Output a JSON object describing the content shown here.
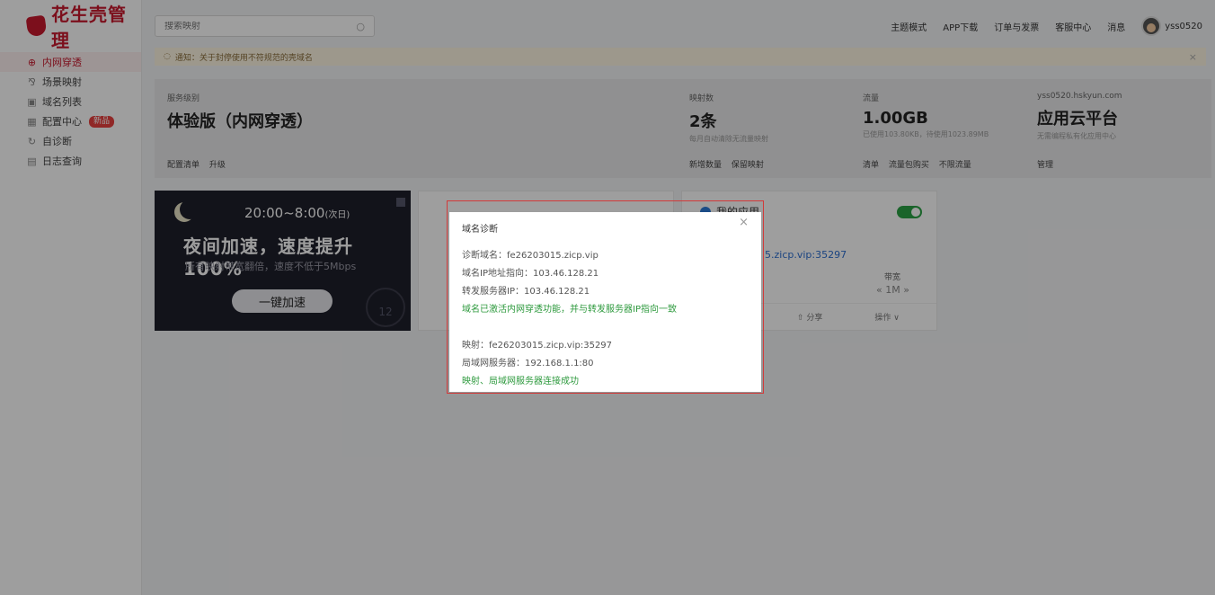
{
  "brand": {
    "name": "花生壳管理",
    "color": "#c8192e"
  },
  "sidebar": {
    "items": [
      {
        "label": "内网穿透",
        "icon": "globe-icon",
        "active": true
      },
      {
        "label": "场景映射",
        "icon": "scene-icon"
      },
      {
        "label": "域名列表",
        "icon": "domain-icon"
      },
      {
        "label": "配置中心",
        "icon": "config-icon",
        "badge": "新品"
      },
      {
        "label": "自诊断",
        "icon": "diagnose-icon"
      },
      {
        "label": "日志查询",
        "icon": "log-icon"
      }
    ]
  },
  "topbar": {
    "search_placeholder": "搜索映射",
    "links": [
      "主题模式",
      "APP下载",
      "订单与发票",
      "客服中心",
      "消息"
    ],
    "username": "yss0520"
  },
  "notice": {
    "text": "通知：关于封停使用不符规范的壳域名"
  },
  "summary": {
    "service": {
      "label": "服务级别",
      "value": "体验版（内网穿透）",
      "links": [
        "配置清单",
        "升级"
      ]
    },
    "mappings": {
      "label": "映射数",
      "value": "2条",
      "sub": "每月自动清除无流量映射",
      "links": [
        "新增数量",
        "保留映射"
      ]
    },
    "traffic": {
      "label": "流量",
      "value": "1.00GB",
      "sub": "已使用103.80KB，待使用1023.89MB",
      "links": [
        "清单",
        "流量包购买",
        "不限流量"
      ]
    },
    "cloud": {
      "label": "yss0520.hskyun.com",
      "value": "应用云平台",
      "sub": "无需编程私有化应用中心",
      "links": [
        "管理"
      ]
    }
  },
  "promo": {
    "time": "20:00~8:00",
    "time_note": "(次日)",
    "title": "夜间加速，速度提升100%",
    "sub": "所有映射带宽翻倍，速度不低于5Mbps",
    "button": "一键加速",
    "clock": "12"
  },
  "app_card": {
    "title": "我的应用",
    "mapping": "5.zicp.vip:35297",
    "bandwidth_label": "带宽",
    "bandwidth_value": "« 1M »",
    "share": "分享",
    "ops": "操作 ∨"
  },
  "dialog": {
    "title": "域名诊断",
    "lines": [
      "诊断域名：fe26203015.zicp.vip",
      "域名IP地址指向：103.46.128.21",
      "转发服务器IP：103.46.128.21"
    ],
    "ok1": "域名已激活内网穿透功能，并与转发服务器IP指向一致",
    "lines2": [
      "映射：fe26203015.zicp.vip:35297",
      "局域网服务器：192.168.1.1:80"
    ],
    "ok2": "映射、局域网服务器连接成功"
  }
}
